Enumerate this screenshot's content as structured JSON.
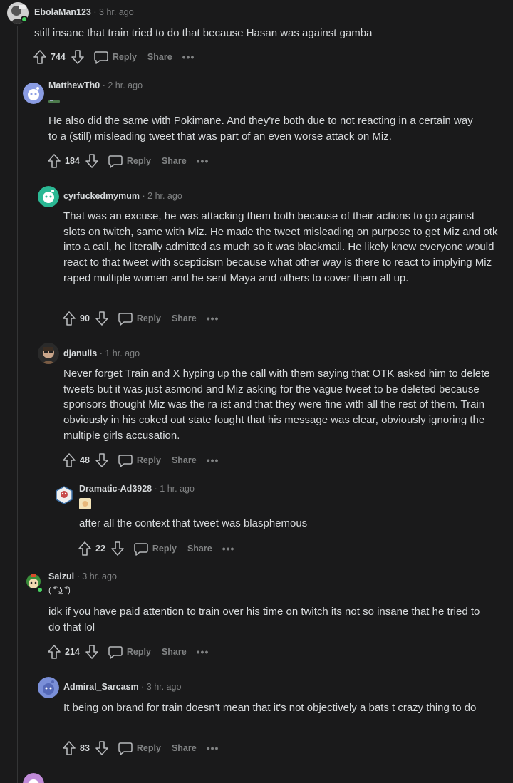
{
  "comments": [
    {
      "username": "EbolaMan123",
      "time": "3 hr. ago",
      "flair": "",
      "body": "still insane that train tried to do that because Hasan was against gamba",
      "score": "744",
      "reply_label": "Reply",
      "share_label": "Share",
      "more_label": "•••"
    },
    {
      "username": "MatthewTh0",
      "time": "2 hr. ago",
      "flair": "",
      "body": "He also did the same with Pokimane. And they're both due to not reacting in a certain way to a (still) misleading tweet that was part of an even worse attack on Miz.",
      "score": "184",
      "reply_label": "Reply",
      "share_label": "Share",
      "more_label": "•••"
    },
    {
      "username": "cyrfuckedmymum",
      "time": "2 hr. ago",
      "flair": "",
      "body": "That was an excuse, he was attacking them both because of their actions to go against slots on twitch, same with Miz. He made the tweet misleading on purpose to get Miz and otk into a call, he literally admitted as much so it was blackmail. He likely knew everyone would react to that tweet with scepticism because what other way is there to react to implying Miz raped multiple women and he sent Maya and others to cover them all up.",
      "score": "90",
      "reply_label": "Reply",
      "share_label": "Share",
      "more_label": "•••"
    },
    {
      "username": "djanulis",
      "time": "1 hr. ago",
      "flair": "",
      "body": "Never forget Train and X hyping up the call with them saying that OTK asked him to delete tweets but it was just asmond and Miz asking for the vague tweet to be deleted because sponsors thought Miz was the ra  ist and that they were fine with all the rest of them. Train obviously in his coked out state fought that his message was clear, obviously ignoring the multiple girls accusation.",
      "score": "48",
      "reply_label": "Reply",
      "share_label": "Share",
      "more_label": "•••"
    },
    {
      "username": "Dramatic-Ad3928",
      "time": "1 hr. ago",
      "flair": "",
      "body": "after all the context that tweet was blasphemous",
      "score": "22",
      "reply_label": "Reply",
      "share_label": "Share",
      "more_label": "•••"
    },
    {
      "username": "Saizul",
      "time": "3 hr. ago",
      "flair": "( ͡° ͜ʖ ͡°)",
      "body": "idk if you have paid attention to train over his time on twitch its not so insane that he tried to do that lol",
      "score": "214",
      "reply_label": "Reply",
      "share_label": "Share",
      "more_label": "•••"
    },
    {
      "username": "Admiral_Sarcasm",
      "time": "3 hr. ago",
      "flair": "",
      "body": "It being on brand for train doesn't mean that it's not objectively a bats   t crazy thing to do",
      "score": "83",
      "reply_label": "Reply",
      "share_label": "Share",
      "more_label": "•••"
    }
  ],
  "separator": "·",
  "colors": {
    "background": "#1a1a1b",
    "text": "#d7dadc",
    "meta": "#818384",
    "thread_line": "#343536",
    "online": "#46d160"
  }
}
